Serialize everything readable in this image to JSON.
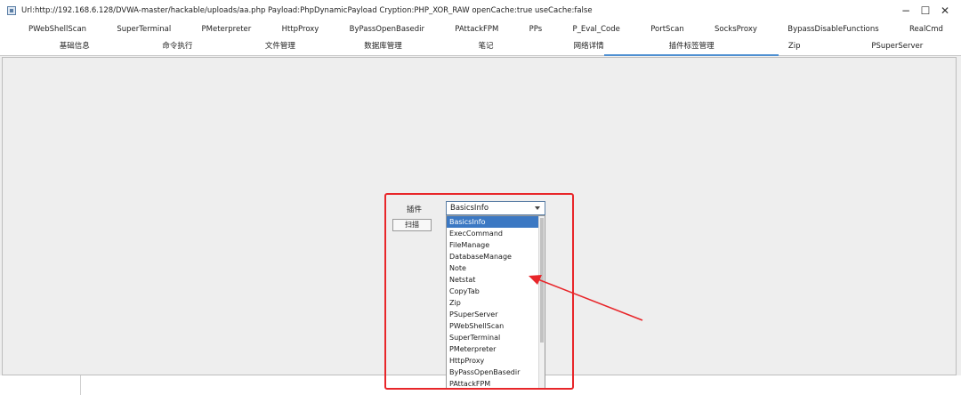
{
  "window": {
    "title": "Url:http://192.168.6.128/DVWA-master/hackable/uploads/aa.php Payload:PhpDynamicPayload Cryption:PHP_XOR_RAW openCache:true useCache:false",
    "controls": {
      "minimize": "−",
      "maximize": "☐",
      "close": "✕"
    }
  },
  "plugin_tabs": [
    "PWebShellScan",
    "SuperTerminal",
    "PMeterpreter",
    "HttpProxy",
    "ByPassOpenBasedir",
    "PAttackFPM",
    "PPs",
    "P_Eval_Code",
    "PortScan",
    "SocksProxy",
    "BypassDisableFunctions",
    "RealCmd"
  ],
  "main_tabs": [
    "基础信息",
    "命令执行",
    "文件管理",
    "数据库管理",
    "笔记",
    "网络详情",
    "插件标签管理",
    "Zip",
    "PSuperServer"
  ],
  "active_main_tab": "插件标签管理",
  "form": {
    "plugin_label": "插件",
    "scan_button": "扫描",
    "combo_value": "BasicsInfo"
  },
  "dropdown_options": [
    "BasicsInfo",
    "ExecCommand",
    "FileManage",
    "DatabaseManage",
    "Note",
    "Netstat",
    "CopyTab",
    "Zip",
    "PSuperServer",
    "PWebShellScan",
    "SuperTerminal",
    "PMeterpreter",
    "HttpProxy",
    "ByPassOpenBasedir",
    "PAttackFPM"
  ],
  "selected_option": "BasicsInfo",
  "colors": {
    "accent": "#4e8fd1",
    "selection": "#3b78c3",
    "annotation": "#e8262a"
  }
}
